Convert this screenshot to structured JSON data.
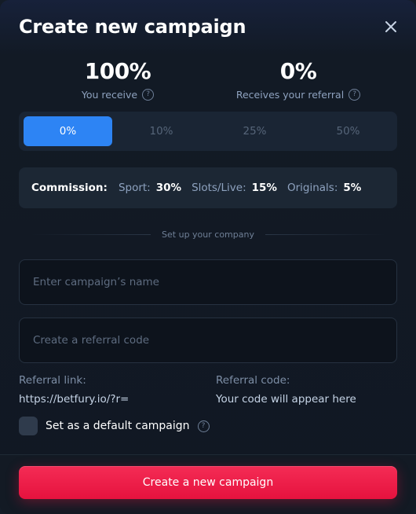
{
  "dialog": {
    "title": "Create new campaign",
    "close_icon": "close-icon"
  },
  "split": {
    "you_receive_value": "100%",
    "you_receive_label": "You receive",
    "referral_value": "0%",
    "referral_label": "Receives your referral",
    "help_icon": "question-circle-icon"
  },
  "share_options": {
    "items": [
      "0%",
      "10%",
      "25%",
      "50%"
    ],
    "selected": "0%"
  },
  "commission": {
    "heading": "Commission:",
    "sport_label": "Sport:",
    "sport_value": "30%",
    "slots_label": "Slots/Live:",
    "slots_value": "15%",
    "originals_label": "Originals:",
    "originals_value": "5%"
  },
  "setup": {
    "divider_text": "Set up your company",
    "name_placeholder": "Enter campaign’s name",
    "name_value": "",
    "code_placeholder": "Create a referral code",
    "code_value": ""
  },
  "referral": {
    "link_label": "Referral link:",
    "link_value": "https://betfury.io/?r=",
    "code_label": "Referral code:",
    "code_value": "Your code will appear here"
  },
  "default_campaign": {
    "label": "Set as a default campaign",
    "checked": false
  },
  "footer": {
    "cta_label": "Create a new campaign"
  },
  "colors": {
    "accent": "#2d84f4",
    "cta": "#e6123e",
    "background": "#111823"
  }
}
